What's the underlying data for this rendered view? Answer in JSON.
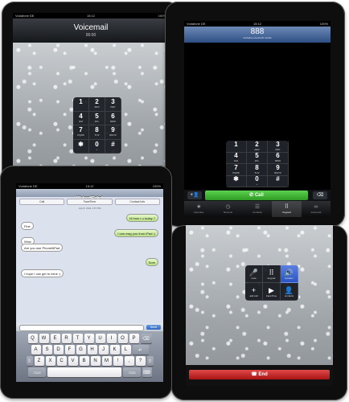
{
  "ipad_voicemail": {
    "status": {
      "carrier": "Vodafone DE",
      "time": "15:12",
      "battery": "100%"
    },
    "title": "Voicemail",
    "timer": "00:00",
    "keypad": [
      {
        "digit": "1",
        "letters": ""
      },
      {
        "digit": "2",
        "letters": "ABC"
      },
      {
        "digit": "3",
        "letters": "DEF"
      },
      {
        "digit": "4",
        "letters": "GHI"
      },
      {
        "digit": "5",
        "letters": "JKL"
      },
      {
        "digit": "6",
        "letters": "MNO"
      },
      {
        "digit": "7",
        "letters": "PQRS"
      },
      {
        "digit": "8",
        "letters": "TUV"
      },
      {
        "digit": "9",
        "letters": "WXYZ"
      },
      {
        "digit": "✱",
        "letters": ""
      },
      {
        "digit": "0",
        "letters": "+"
      },
      {
        "digit": "#",
        "letters": ""
      }
    ]
  },
  "ipad_dialer": {
    "status": {
      "carrier": "Vodafone DE",
      "time": "15:12",
      "battery": "100%"
    },
    "number": "888",
    "subtitle": "Guthaben-Auskunft mobile",
    "keypad": [
      {
        "digit": "1",
        "letters": ""
      },
      {
        "digit": "2",
        "letters": "ABC"
      },
      {
        "digit": "3",
        "letters": "DEF"
      },
      {
        "digit": "4",
        "letters": "GHI"
      },
      {
        "digit": "5",
        "letters": "JKL"
      },
      {
        "digit": "6",
        "letters": "MNO"
      },
      {
        "digit": "7",
        "letters": "PQRS"
      },
      {
        "digit": "8",
        "letters": "TUV"
      },
      {
        "digit": "9",
        "letters": "WXYZ"
      },
      {
        "digit": "✱",
        "letters": ""
      },
      {
        "digit": "0",
        "letters": "+"
      },
      {
        "digit": "#",
        "letters": ""
      }
    ],
    "call_label": "Call",
    "tabs": [
      {
        "label": "Favorites",
        "icon": "★"
      },
      {
        "label": "Recents",
        "icon": "◷"
      },
      {
        "label": "Contacts",
        "icon": "☰"
      },
      {
        "label": "Keypad",
        "icon": "⠿"
      },
      {
        "label": "Voicemail",
        "icon": "∞"
      }
    ],
    "active_tab": "Keypad"
  },
  "ipad_messages": {
    "status": {
      "carrier": "Vodafone DE",
      "time": "15:12",
      "battery": "100%"
    },
    "contact": "Waleed Rehel",
    "buttons": [
      "Call",
      "FaceTime",
      "Contact Info"
    ],
    "date_header": "July 8, 2011 1:57 PM",
    "messages": [
      {
        "text": "Hi how r u today ?",
        "dir": "out"
      },
      {
        "text": "Fine",
        "dir": "in"
      },
      {
        "text": "I can msg you from iPad :)",
        "dir": "out"
      },
      {
        "text": "Wow",
        "dir": "in"
      },
      {
        "text": "Are you use PhoneItiPad",
        "dir": "in"
      },
      {
        "text": "Sure",
        "dir": "out"
      },
      {
        "text": "I hope I can get to mine :)",
        "dir": "in"
      }
    ],
    "send_label": "Send",
    "keyboard": {
      "row1": [
        "Q",
        "W",
        "E",
        "R",
        "T",
        "Y",
        "U",
        "I",
        "O",
        "P"
      ],
      "row2": [
        "A",
        "S",
        "D",
        "F",
        "G",
        "H",
        "J",
        "K",
        "L"
      ],
      "row3": [
        "Z",
        "X",
        "C",
        "V",
        "B",
        "N",
        "M",
        "!",
        ",",
        "?"
      ],
      "row4_left": ".?123",
      "row4_right": ".?123"
    }
  },
  "ipad_incall": {
    "controls": [
      {
        "label": "mute",
        "icon": "🎤"
      },
      {
        "label": "keypad",
        "icon": "⠿"
      },
      {
        "label": "speaker",
        "icon": "🔊"
      },
      {
        "label": "add call",
        "icon": "+"
      },
      {
        "label": "FaceTime",
        "icon": "▶"
      },
      {
        "label": "contacts",
        "icon": "👤"
      }
    ],
    "active_control": "speaker",
    "end_label": "End"
  }
}
